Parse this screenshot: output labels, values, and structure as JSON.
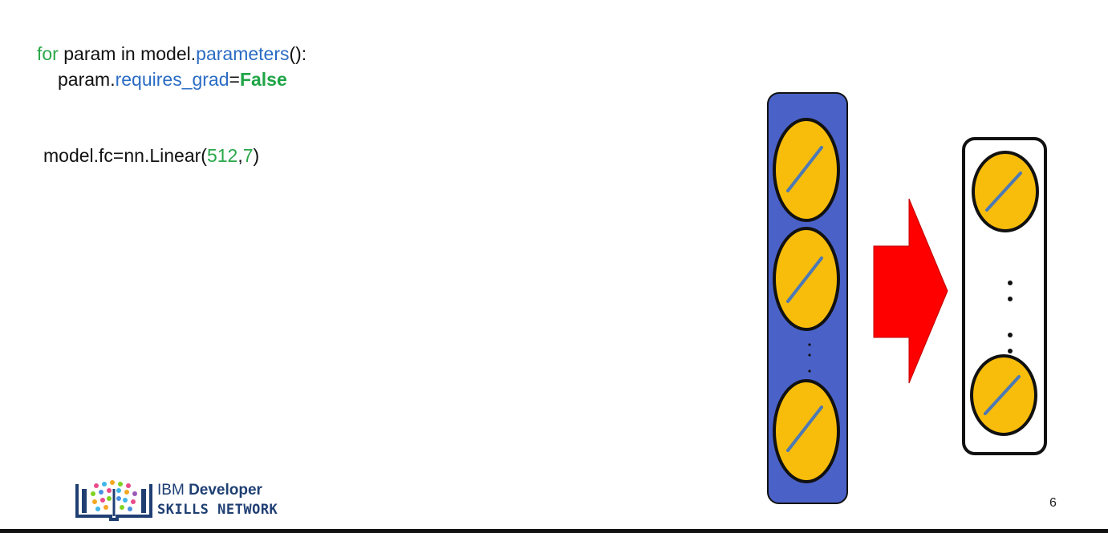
{
  "code": {
    "line1": {
      "kw": "for",
      "mid": " param in model.",
      "method": "parameters",
      "end": "():"
    },
    "line2": {
      "pre": "param.",
      "attr": "requires_grad",
      "eq": "=",
      "val": "False"
    },
    "line3": {
      "pre": "model.fc=nn.Linear(",
      "arg1": "512",
      "comma": ",",
      "arg2": "7",
      "end": ")"
    }
  },
  "diagram": {
    "left_layer": {
      "color": "#4a62c8",
      "neuron_count_shown": 3,
      "has_ellipsis": true
    },
    "arrow": {
      "color": "#ff0000",
      "direction": "right"
    },
    "right_layer": {
      "color": "#ffffff",
      "neuron_count_shown": 2,
      "has_ellipsis": true
    },
    "neuron_fill": "#f8bd0b"
  },
  "logo": {
    "line1_regular": "IBM ",
    "line1_bold": "Developer",
    "line2": "SKILLS NETWORK"
  },
  "page_number": "6"
}
